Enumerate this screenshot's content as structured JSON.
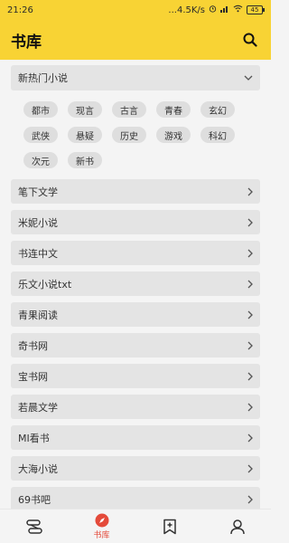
{
  "status": {
    "time": "21:26",
    "net_speed": "...4.5K/s",
    "battery": "45"
  },
  "appbar": {
    "title": "书库"
  },
  "section": {
    "title": "新热门小说",
    "tags": [
      "都市",
      "现言",
      "古言",
      "青春",
      "玄幻",
      "武侠",
      "悬疑",
      "历史",
      "游戏",
      "科幻",
      "次元",
      "新书"
    ]
  },
  "list": [
    "笔下文学",
    "米妮小说",
    "书连中文",
    "乐文小说txt",
    "青果阅读",
    "奇书网",
    "宝书网",
    "若晨文学",
    "MI看书",
    "大海小说",
    "69书吧"
  ],
  "bottom_nav": {
    "active_label": "书库",
    "accent": "#e44a3a"
  },
  "colors": {
    "header": "#f8d334"
  }
}
